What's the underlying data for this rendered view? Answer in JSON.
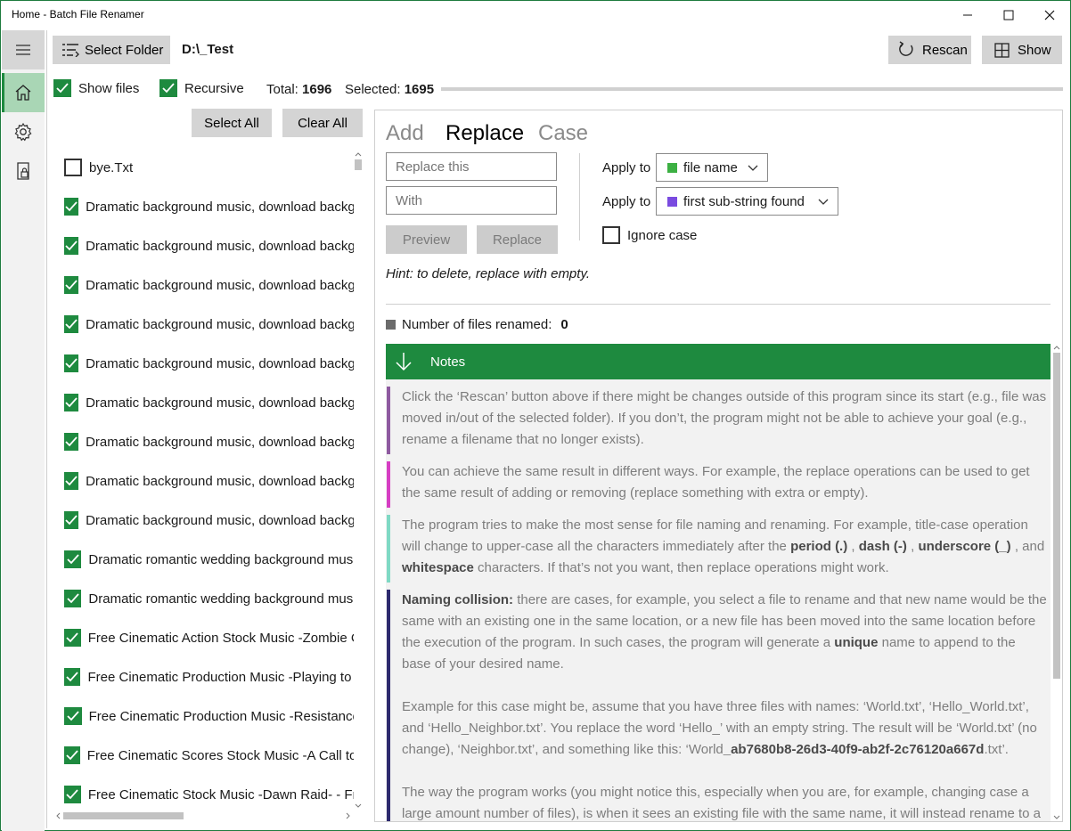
{
  "window": {
    "title": "Home - Batch File Renamer",
    "minimize": "—",
    "maximize": "☐",
    "close": "✕"
  },
  "nav": {
    "items": [
      "menu",
      "home",
      "settings",
      "privacy"
    ]
  },
  "toolbar": {
    "select_folder": "Select Folder",
    "folder_path": "D:\\_Test",
    "rescan": "Rescan",
    "show": "Show"
  },
  "options": {
    "show_files": {
      "label": "Show files",
      "checked": true
    },
    "recursive": {
      "label": "Recursive",
      "checked": true
    },
    "total_label": "Total:",
    "total_value": "1696",
    "selected_label": "Selected:",
    "selected_value": "1695"
  },
  "list_actions": {
    "select_all": "Select All",
    "clear_all": "Clear All"
  },
  "files": [
    {
      "name": "bye.Txt",
      "checked": false
    },
    {
      "name": "Dramatic background music, download background music",
      "checked": true
    },
    {
      "name": "Dramatic background music, download background music",
      "checked": true
    },
    {
      "name": "Dramatic background music, download background music",
      "checked": true
    },
    {
      "name": "Dramatic background music, download background music",
      "checked": true
    },
    {
      "name": "Dramatic background music, download background music",
      "checked": true
    },
    {
      "name": "Dramatic background music, download background music",
      "checked": true
    },
    {
      "name": "Dramatic background music, download background music",
      "checked": true
    },
    {
      "name": "Dramatic background music, download background music",
      "checked": true
    },
    {
      "name": "Dramatic background music, download background music",
      "checked": true
    },
    {
      "name": "Dramatic romantic wedding background music",
      "checked": true
    },
    {
      "name": "Dramatic romantic wedding background music",
      "checked": true
    },
    {
      "name": "Free Cinematic Action Stock Music -Zombie City",
      "checked": true
    },
    {
      "name": "Free Cinematic Production Music -Playing to Win",
      "checked": true
    },
    {
      "name": "Free Cinematic Production Music -Resistance",
      "checked": true
    },
    {
      "name": "Free Cinematic Scores Stock Music -A Call to Arms",
      "checked": true
    },
    {
      "name": "Free Cinematic Stock Music -Dawn Raid- - Free",
      "checked": true
    }
  ],
  "tabs": {
    "add": "Add",
    "replace": "Replace",
    "case": "Case",
    "active": "replace"
  },
  "replace": {
    "find_placeholder": "Replace this",
    "with_placeholder": "With",
    "preview": "Preview",
    "replace": "Replace",
    "apply_label_1": "Apply to",
    "apply_value_1": "file name",
    "apply_color_1": "#3cb043",
    "apply_label_2": "Apply to",
    "apply_value_2": "first sub-string found",
    "apply_color_2": "#7a4be0",
    "ignore_case": "Ignore case",
    "ignore_case_checked": false,
    "hint": "Hint: to delete, replace with empty."
  },
  "status": {
    "renamed_label": "Number of files renamed:",
    "renamed_value": "0"
  },
  "notes": {
    "header": "Notes",
    "n1": "Click the ‘Rescan’ button above if there might be changes outside of this program since its start (e.g., file was moved in/out of the selected folder). If you don’t, the program might not be able to achieve your goal (e.g., rename a filename that no longer exists).",
    "n1_color": "#8e5aa0",
    "n2": "You can achieve the same result in different ways. For example, the replace operations can be used to get the same result of adding or removing (replace something with extra or empty).",
    "n2_color": "#d63ec3",
    "n3_a": "The program tries to make the most sense for file naming and renaming. For example, title-case operation will change to upper-case all the characters immediately after the",
    "n3_b1": "period (.)",
    "n3_c1": ",",
    "n3_b2": "dash (-)",
    "n3_c2": ",",
    "n3_b3": "underscore (_)",
    "n3_c3": ", and",
    "n3_b4": "whitespace",
    "n3_d": "characters. If that’s not you want, then replace operations might work.",
    "n3_color": "#7fd9c4",
    "n4_b1": "Naming collision:",
    "n4_a": "there are cases, for example, you select a file to rename and that new name would be the same with an existing one in the same location, or a new file has been moved into the same location before the execution of the program. In such cases, the program will generate a",
    "n4_b2": "unique",
    "n4_c": "name to append to the base of your desired name.",
    "n4_p2_a": "Example for this case might be, assume that you have three files with names: ‘World.txt’, ‘Hello_World.txt’, and ‘Hello_Neighbor.txt’. You replace the word ‘Hello_’ with an empty string. The result will be ‘World.txt’ (no change), ‘Neighbor.txt’, and something like this: ‘World",
    "n4_p2_b": "_ab7680b8-26d3-40f9-ab2f-2c76120a667d",
    "n4_p2_c": ".txt’.",
    "n4_p3": "The way the program works (you might notice this, especially when you are, for example, changing case a large amount number of files), is when it sees an existing file with the same name, it will instead rename to a",
    "n4_color": "#2d2a6e"
  },
  "colors": {
    "accent": "#1e8a3f",
    "nav_selected": "#a9d6b5",
    "button_gray": "#d4d4d4"
  }
}
